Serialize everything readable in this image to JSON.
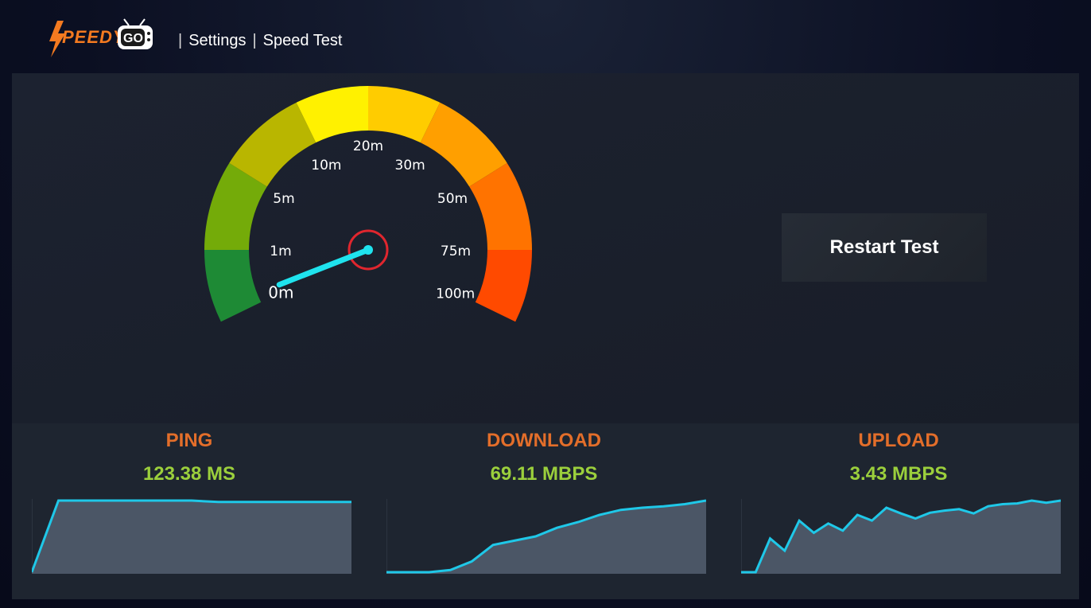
{
  "header": {
    "logo_text": "SPEEDY GO",
    "breadcrumb": [
      "Settings",
      "Speed Test"
    ],
    "separator": "|"
  },
  "gauge": {
    "labels": [
      "0m",
      "1m",
      "5m",
      "10m",
      "20m",
      "30m",
      "50m",
      "75m",
      "100m"
    ],
    "needle_value_fraction": 0.02,
    "segment_colors": [
      "#1e8a35",
      "#74ab09",
      "#b9b600",
      "#fff100",
      "#ffcc00",
      "#ff9f00",
      "#ff7300",
      "#ff4a00"
    ],
    "needle_color": "#1fe3ee",
    "hub_ring_color": "#e0262e"
  },
  "controls": {
    "restart_label": "Restart Test"
  },
  "stats": [
    {
      "id": "ping",
      "title": "PING",
      "value": "123.38 MS"
    },
    {
      "id": "download",
      "title": "DOWNLOAD",
      "value": "69.11 MBPS"
    },
    {
      "id": "upload",
      "title": "UPLOAD",
      "value": "3.43 MBPS"
    }
  ],
  "colors": {
    "stat_title": "#e36e2a",
    "stat_value": "#9bcf3c",
    "graph_line": "#1fc8e8",
    "graph_fill": "#4b5666"
  },
  "chart_data": [
    {
      "type": "area",
      "series": [
        {
          "values": [
            0,
            1.0,
            1.0,
            1.0,
            1.0,
            1.0,
            1.0,
            0.98,
            0.98,
            0.98,
            0.98,
            0.98,
            0.98
          ]
        }
      ]
    },
    {
      "type": "area",
      "series": [
        {
          "values": [
            0,
            0,
            0,
            0.03,
            0.15,
            0.38,
            0.44,
            0.5,
            0.62,
            0.7,
            0.8,
            0.87,
            0.9,
            0.92,
            0.95,
            1.0
          ]
        }
      ]
    },
    {
      "type": "area",
      "series": [
        {
          "values": [
            0,
            0,
            0.47,
            0.3,
            0.72,
            0.55,
            0.68,
            0.58,
            0.8,
            0.72,
            0.9,
            0.82,
            0.75,
            0.83,
            0.86,
            0.88,
            0.82,
            0.92,
            0.95,
            0.96,
            1.0,
            0.97,
            1.0
          ]
        }
      ]
    }
  ]
}
